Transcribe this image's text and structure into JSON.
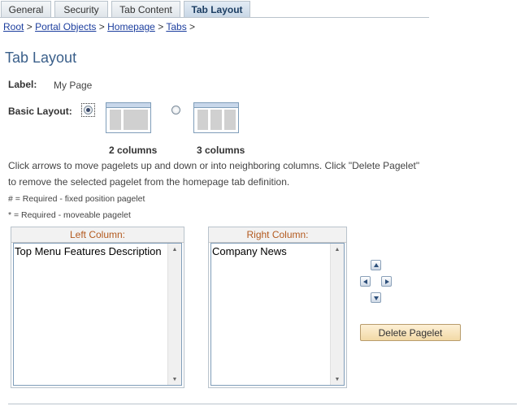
{
  "tabs": [
    {
      "label": "General",
      "active": false
    },
    {
      "label": "Security",
      "active": false
    },
    {
      "label": "Tab Content",
      "active": false
    },
    {
      "label": "Tab Layout",
      "active": true
    }
  ],
  "breadcrumb": {
    "items": [
      "Root",
      "Portal Objects",
      "Homepage",
      "Tabs"
    ],
    "separator": ">"
  },
  "page_title": "Tab Layout",
  "label_field": {
    "label": "Label:",
    "value": "My Page"
  },
  "basic_layout": {
    "label": "Basic Layout:",
    "options": [
      {
        "caption": "2 columns",
        "selected": true
      },
      {
        "caption": "3 columns",
        "selected": false
      }
    ]
  },
  "instructions": {
    "line1": "Click arrows to move pagelets up and down or into neighboring columns. Click \"Delete Pagelet\"",
    "line2": "to remove the selected pagelet from the homepage tab definition.",
    "note_fixed": "# = Required - fixed position pagelet",
    "note_moveable": "* = Required - moveable pagelet"
  },
  "left_column": {
    "header": "Left Column:",
    "items": [
      "Top Menu Features Description"
    ]
  },
  "right_column": {
    "header": "Right Column:",
    "items": [
      "Company News"
    ]
  },
  "move_buttons": [
    "arrow-up-icon",
    "arrow-left-icon",
    "arrow-right-icon",
    "arrow-down-icon"
  ],
  "delete_button": "Delete Pagelet",
  "colors": {
    "tab_active_text": "#1c3e63",
    "title": "#3a5f8a",
    "column_header_text": "#b35a1f",
    "link": "#1c3e9e",
    "delete_button_bg": "#f2d9a6"
  }
}
